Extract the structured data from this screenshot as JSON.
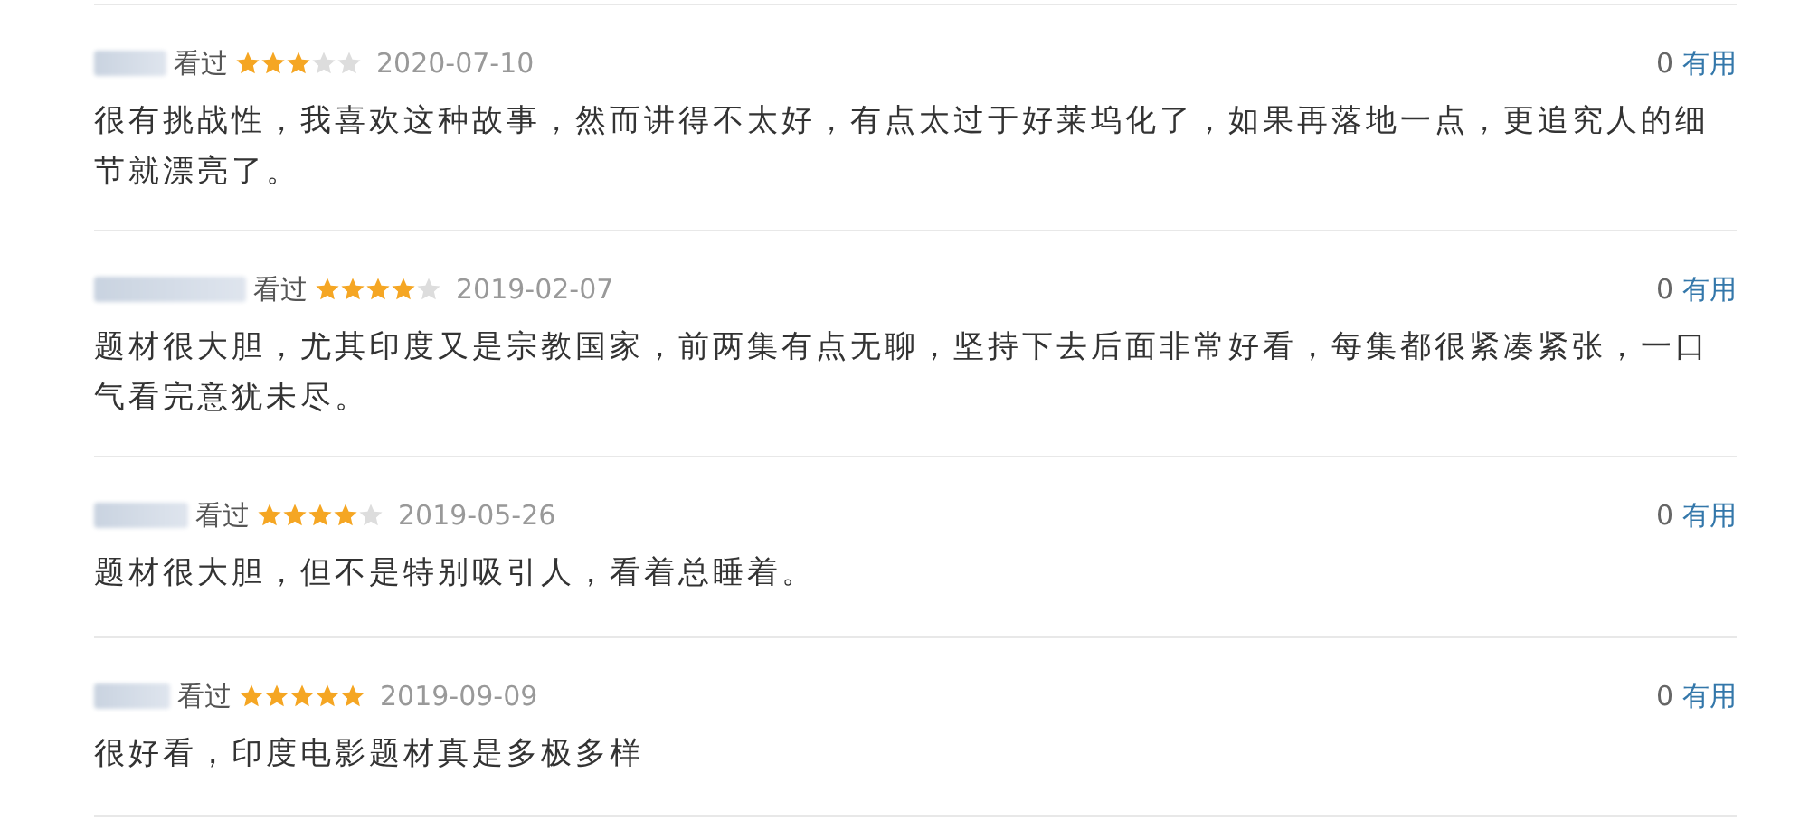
{
  "reviews": [
    {
      "status": "看过",
      "stars": 3,
      "date": "2020-07-10",
      "votes": "0",
      "vote_label": "有用",
      "text": "很有挑战性，我喜欢这种故事，然而讲得不太好，有点太过于好莱坞化了，如果再落地一点，更追究人的细节就漂亮了。"
    },
    {
      "status": "看过",
      "stars": 4,
      "date": "2019-02-07",
      "votes": "0",
      "vote_label": "有用",
      "text": "题材很大胆，尤其印度又是宗教国家，前两集有点无聊，坚持下去后面非常好看，每集都很紧凑紧张，一口气看完意犹未尽。"
    },
    {
      "status": "看过",
      "stars": 4,
      "date": "2019-05-26",
      "votes": "0",
      "vote_label": "有用",
      "text": "题材很大胆，但不是特别吸引人，看着总睡着。"
    },
    {
      "status": "看过",
      "stars": 5,
      "date": "2019-09-09",
      "votes": "0",
      "vote_label": "有用",
      "text": "很好看，印度电影题材真是多极多样"
    }
  ]
}
